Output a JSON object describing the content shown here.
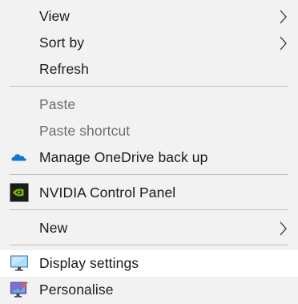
{
  "menu": {
    "items": [
      {
        "label": "View",
        "icon": "",
        "has_submenu": true,
        "enabled": true
      },
      {
        "label": "Sort by",
        "icon": "",
        "has_submenu": true,
        "enabled": true
      },
      {
        "label": "Refresh",
        "icon": "",
        "has_submenu": false,
        "enabled": true
      },
      {
        "label": "Paste",
        "icon": "",
        "has_submenu": false,
        "enabled": false
      },
      {
        "label": "Paste shortcut",
        "icon": "",
        "has_submenu": false,
        "enabled": false
      },
      {
        "label": "Manage OneDrive back up",
        "icon": "onedrive-cloud-icon",
        "has_submenu": false,
        "enabled": true
      },
      {
        "label": "NVIDIA Control Panel",
        "icon": "nvidia-icon",
        "has_submenu": false,
        "enabled": true
      },
      {
        "label": "New",
        "icon": "",
        "has_submenu": true,
        "enabled": true
      },
      {
        "label": "Display settings",
        "icon": "monitor-icon",
        "has_submenu": false,
        "enabled": true,
        "highlighted": true
      },
      {
        "label": "Personalise",
        "icon": "personalise-icon",
        "has_submenu": false,
        "enabled": true
      }
    ]
  },
  "colors": {
    "menu_background": "#f2f2f2",
    "hover_background": "#ffffff",
    "text": "#1a1a1a",
    "disabled_text": "#6d6d6d",
    "separator": "#bdbdbd",
    "onedrive_blue": "#0f78d4",
    "nvidia_green": "#76b900"
  }
}
